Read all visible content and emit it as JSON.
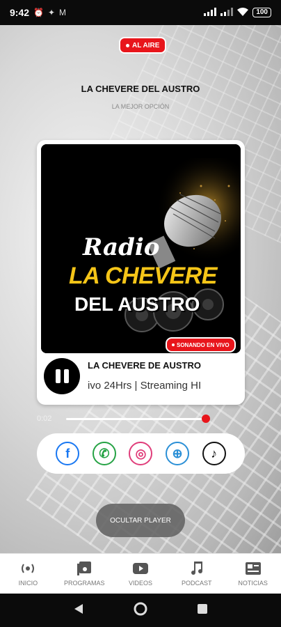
{
  "status_bar": {
    "time": "9:42",
    "battery": "100"
  },
  "header": {
    "live_badge": "AL AIRE",
    "title": "LA CHEVERE DEL AUSTRO",
    "subtitle": "LA MEJOR OPCIÓN"
  },
  "cover": {
    "line1": "Radio",
    "line2": "LA CHEVERE",
    "line3": "DEL AUSTRO",
    "playing_badge": "SONANDO EN VIVO"
  },
  "player": {
    "track_title": "LA CHEVERE DE AUSTRO",
    "track_marquee": "ivo 24Hrs | Streaming HI",
    "elapsed": "0:02",
    "progress": 0.98
  },
  "social": [
    {
      "name": "facebook",
      "glyph": "f"
    },
    {
      "name": "whatsapp",
      "glyph": "✆"
    },
    {
      "name": "instagram",
      "glyph": "◎"
    },
    {
      "name": "website",
      "glyph": "⊕"
    },
    {
      "name": "tiktok",
      "glyph": "♪"
    }
  ],
  "hide_button": "OCULTAR PLAYER",
  "nav": [
    {
      "label": "INICIO",
      "icon": "broadcast-icon"
    },
    {
      "label": "PROGRAMAS",
      "icon": "playlist-icon"
    },
    {
      "label": "VIDEOS",
      "icon": "youtube-icon"
    },
    {
      "label": "PODCAST",
      "icon": "music-note-icon"
    },
    {
      "label": "NOTICIAS",
      "icon": "news-icon"
    }
  ],
  "colors": {
    "accent": "#e8151b",
    "cover_yellow": "#f5c518"
  }
}
